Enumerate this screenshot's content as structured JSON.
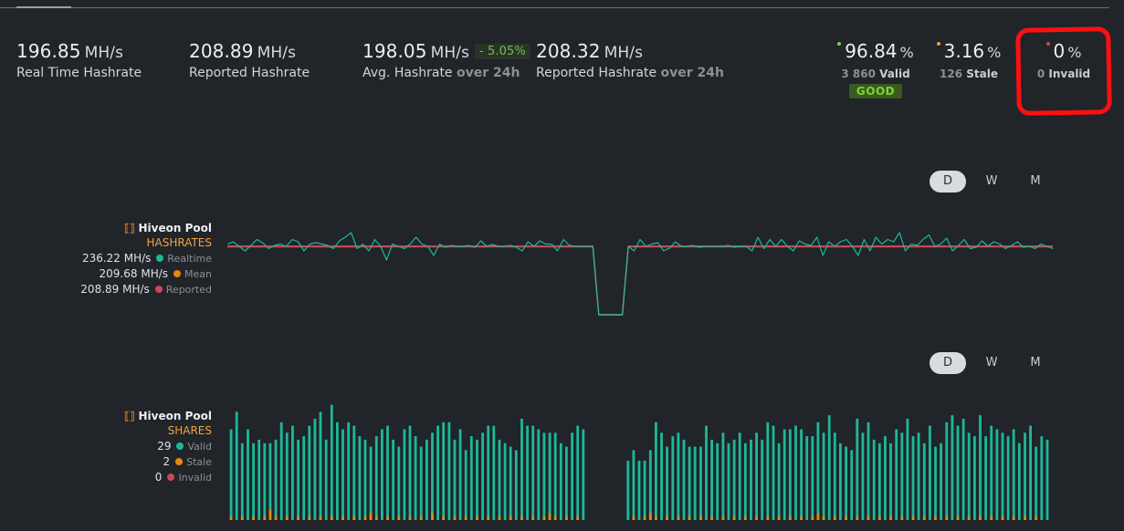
{
  "hashrate": {
    "realtime": {
      "value": "196.85",
      "unit": "MH/s",
      "label": "Real Time Hashrate"
    },
    "reported": {
      "value": "208.89",
      "unit": "MH/s",
      "label": "Reported Hashrate"
    },
    "avg": {
      "value": "198.05",
      "unit": "MH/s",
      "label": "Avg. Hashrate",
      "period": "over 24h",
      "delta": "- 5.05%"
    },
    "reported_avg": {
      "value": "208.32",
      "unit": "MH/s",
      "label": "Reported Hashrate",
      "period": "over 24h"
    }
  },
  "shares": {
    "valid": {
      "pct": "96.84",
      "unit": "%",
      "count": "3 860",
      "label": "Valid",
      "badge": "GOOD",
      "color": "#7fd13b"
    },
    "stale": {
      "pct": "3.16",
      "unit": "%",
      "count": "126",
      "label": "Stale",
      "color": "#f0a030"
    },
    "invalid": {
      "pct": "0",
      "unit": "%",
      "count": "0",
      "label": "Invalid",
      "color": "#e04050"
    }
  },
  "toggles": [
    "D",
    "W",
    "M"
  ],
  "active_toggle": "D",
  "hash_legend": {
    "brand": "Hiveon Pool",
    "subtitle": "HASHRATES",
    "rows": [
      {
        "value": "236.22 MH/s",
        "name": "Realtime",
        "color": "#1bb99a"
      },
      {
        "value": "209.68 MH/s",
        "name": "Mean",
        "color": "#e8860e"
      },
      {
        "value": "208.89 MH/s",
        "name": "Reported",
        "color": "#c9455e"
      }
    ]
  },
  "shares_legend": {
    "brand": "Hiveon Pool",
    "subtitle": "SHARES",
    "rows": [
      {
        "value": "29",
        "name": "Valid",
        "color": "#1bb99a"
      },
      {
        "value": "2",
        "name": "Stale",
        "color": "#e8860e"
      },
      {
        "value": "0",
        "name": "Invalid",
        "color": "#c9455e"
      }
    ]
  },
  "chart_data": [
    {
      "type": "line",
      "series": [
        {
          "name": "Realtime",
          "color": "#1bb99a",
          "values": [
            215,
            220,
            210,
            200,
            212,
            225,
            218,
            205,
            212,
            215,
            210,
            225,
            220,
            200,
            215,
            218,
            215,
            212,
            205,
            222,
            230,
            240,
            205,
            215,
            200,
            225,
            210,
            180,
            215,
            210,
            205,
            215,
            230,
            215,
            210,
            190,
            215,
            208,
            212,
            210,
            210,
            212,
            208,
            222,
            210,
            214,
            210,
            210,
            212,
            208,
            200,
            220,
            210,
            222,
            215,
            215,
            200,
            225,
            212,
            210,
            210,
            210,
            210,
            60,
            60,
            60,
            60,
            60,
            210,
            200,
            225,
            210,
            215,
            218,
            200,
            206,
            220,
            210,
            210,
            212,
            208,
            210,
            210,
            210,
            210,
            212,
            208,
            210,
            210,
            200,
            230,
            205,
            225,
            210,
            225,
            210,
            200,
            222,
            215,
            212,
            230,
            190,
            220,
            210,
            220,
            225,
            210,
            190,
            225,
            200,
            230,
            215,
            225,
            220,
            240,
            200,
            215,
            212,
            225,
            235,
            210,
            215,
            228,
            200,
            212,
            225,
            205,
            208,
            222,
            210,
            220,
            215,
            205,
            212,
            220,
            208,
            210,
            205,
            215,
            210,
            205
          ]
        },
        {
          "name": "Mean",
          "color": "#e8860e",
          "values": [
            210,
            210,
            210,
            210,
            210,
            210,
            210,
            210,
            210,
            210,
            210,
            210,
            210,
            210,
            210,
            210,
            210,
            210,
            210,
            210,
            210,
            210,
            210,
            210,
            210,
            210,
            210,
            210,
            210,
            210,
            210,
            210,
            210,
            210,
            210,
            210,
            210,
            210,
            210,
            210,
            210,
            210,
            210,
            210,
            210,
            210,
            210,
            210,
            210,
            210,
            210,
            210,
            210,
            210,
            210,
            210,
            210,
            210,
            210,
            210,
            210,
            210,
            210,
            60,
            60,
            60,
            60,
            60,
            210,
            210,
            210,
            210,
            210,
            210,
            210,
            210,
            210,
            210,
            210,
            210,
            210,
            210,
            210,
            210,
            210,
            210,
            210,
            210,
            210,
            210,
            210,
            210,
            210,
            210,
            210,
            210,
            210,
            210,
            210,
            210,
            210,
            210,
            210,
            210,
            210,
            210,
            210,
            210,
            210,
            210,
            210,
            210,
            210,
            210,
            210,
            210,
            210,
            210,
            210,
            210,
            210,
            210,
            210,
            210,
            210,
            210,
            210,
            210,
            210,
            210,
            210,
            210,
            210,
            210,
            210,
            210,
            210,
            210,
            210,
            210,
            210
          ]
        },
        {
          "name": "Reported",
          "color": "#c9455e",
          "values": [
            209,
            209,
            209,
            209,
            209,
            209,
            209,
            209,
            209,
            209,
            209,
            209,
            209,
            209,
            209,
            209,
            209,
            209,
            209,
            209,
            209,
            209,
            209,
            209,
            209,
            209,
            209,
            209,
            209,
            209,
            209,
            209,
            209,
            209,
            209,
            209,
            209,
            209,
            209,
            209,
            209,
            209,
            209,
            209,
            209,
            209,
            209,
            209,
            209,
            209,
            209,
            209,
            209,
            209,
            209,
            209,
            209,
            209,
            209,
            209,
            209,
            209,
            209,
            60,
            60,
            60,
            60,
            60,
            209,
            209,
            209,
            209,
            209,
            209,
            209,
            209,
            209,
            209,
            209,
            209,
            209,
            209,
            209,
            209,
            209,
            209,
            209,
            209,
            209,
            209,
            209,
            209,
            209,
            209,
            209,
            209,
            209,
            209,
            209,
            209,
            209,
            209,
            209,
            209,
            209,
            209,
            209,
            209,
            209,
            209,
            209,
            209,
            209,
            209,
            209,
            209,
            209,
            209,
            209,
            209,
            209,
            209,
            209,
            209,
            209,
            209,
            209,
            209,
            209,
            209,
            209,
            209,
            209,
            209,
            209,
            209,
            209,
            209,
            209,
            209,
            209
          ]
        }
      ],
      "ylim": [
        40,
        260
      ]
    },
    {
      "type": "bar",
      "series": [
        {
          "name": "Valid",
          "color": "#1bb99a",
          "values": [
            26,
            31,
            22,
            26,
            22,
            23,
            22,
            22,
            23,
            28,
            25,
            27,
            23,
            24,
            27,
            29,
            31,
            23,
            33,
            28,
            26,
            28,
            27,
            24,
            23,
            21,
            24,
            26,
            27,
            23,
            21,
            26,
            27,
            24,
            21,
            23,
            25,
            27,
            28,
            28,
            23,
            26,
            20,
            24,
            23,
            25,
            27,
            27,
            23,
            22,
            21,
            20,
            29,
            27,
            27,
            26,
            25,
            25,
            25,
            22,
            21,
            25,
            27,
            26,
            22,
            22,
            22,
            24,
            21,
            21,
            21,
            17,
            20,
            17,
            17,
            20,
            28,
            25,
            21,
            24,
            25,
            23,
            21,
            21,
            21,
            27,
            23,
            22,
            25,
            22,
            23,
            25,
            22,
            23,
            25,
            23,
            28,
            27,
            22,
            26,
            26,
            27,
            26,
            24,
            24,
            28,
            25,
            30,
            25,
            22,
            21,
            20,
            29,
            25,
            28,
            23,
            22,
            24,
            22,
            26,
            25,
            29,
            24,
            25,
            22,
            27,
            21,
            22,
            28,
            30,
            27,
            29,
            25,
            24,
            30,
            24,
            27,
            26,
            25,
            24,
            26,
            22,
            25,
            27,
            21,
            24,
            23
          ]
        },
        {
          "name": "Stale",
          "color": "#e8860e",
          "values": [
            1,
            0,
            1,
            0,
            1,
            0,
            1,
            3,
            1,
            0,
            1,
            0,
            1,
            0,
            1,
            0,
            1,
            0,
            1,
            0,
            1,
            0,
            1,
            0,
            1,
            2,
            1,
            0,
            1,
            0,
            1,
            0,
            1,
            0,
            1,
            0,
            2,
            0,
            1,
            0,
            1,
            0,
            1,
            0,
            1,
            0,
            1,
            0,
            1,
            0,
            1,
            0,
            1,
            0,
            1,
            0,
            1,
            2,
            1,
            0,
            1,
            0,
            1,
            0,
            1,
            0,
            1,
            0,
            1,
            0,
            1,
            0,
            1,
            0,
            1,
            2,
            1,
            0,
            1,
            0,
            1,
            0,
            1,
            0,
            1,
            0,
            1,
            0,
            1,
            0,
            1,
            0,
            1,
            0,
            1,
            0,
            1,
            0,
            1,
            0,
            1,
            0,
            1,
            0,
            1,
            2,
            1,
            0,
            1,
            0,
            1,
            0,
            1,
            0,
            1,
            0,
            1,
            0,
            1,
            0,
            1,
            0,
            1,
            0,
            1,
            0,
            1,
            0,
            1,
            0,
            1,
            0,
            1,
            0,
            1,
            0,
            1,
            0,
            1,
            0,
            1,
            0,
            1,
            0,
            1,
            0
          ]
        }
      ],
      "gap_indices": [
        64,
        65,
        66,
        67,
        68,
        69,
        70
      ],
      "ylim": [
        0,
        35
      ]
    }
  ]
}
